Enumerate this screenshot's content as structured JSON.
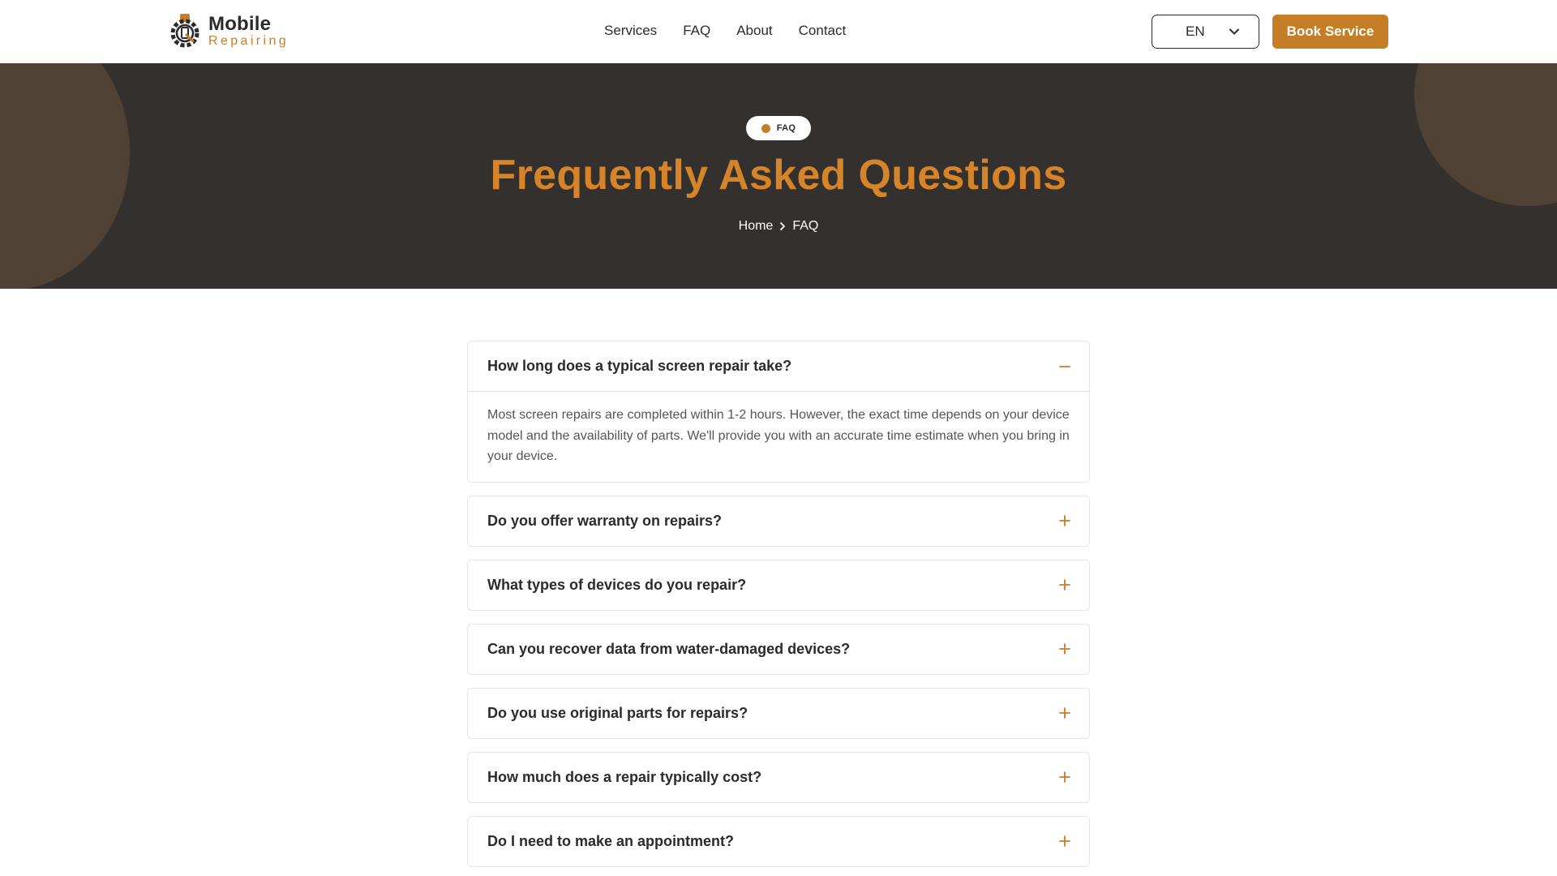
{
  "brand": {
    "name": "Mobile",
    "tagline": "Repairing"
  },
  "nav": {
    "links": [
      "Services",
      "FAQ",
      "About",
      "Contact"
    ],
    "language": "EN",
    "cta": "Book Service"
  },
  "hero": {
    "badge": "FAQ",
    "title": "Frequently Asked Questions",
    "breadcrumb": {
      "home": "Home",
      "current": "FAQ"
    }
  },
  "faq": {
    "items": [
      {
        "question": "How long does a typical screen repair take?",
        "answer": "Most screen repairs are completed within 1-2 hours. However, the exact time depends on your device model and the availability of parts. We'll provide you with an accurate time estimate when you bring in your device.",
        "expanded": true
      },
      {
        "question": "Do you offer warranty on repairs?",
        "expanded": false
      },
      {
        "question": "What types of devices do you repair?",
        "expanded": false
      },
      {
        "question": "Can you recover data from water-damaged devices?",
        "expanded": false
      },
      {
        "question": "Do you use original parts for repairs?",
        "expanded": false
      },
      {
        "question": "How much does a repair typically cost?",
        "expanded": false
      },
      {
        "question": "Do I need to make an appointment?",
        "expanded": false
      }
    ]
  },
  "colors": {
    "accent": "#c57e26",
    "hero_bg": "#33302d",
    "hero_title": "#d6842a",
    "deco_circle": "#4f4235"
  }
}
